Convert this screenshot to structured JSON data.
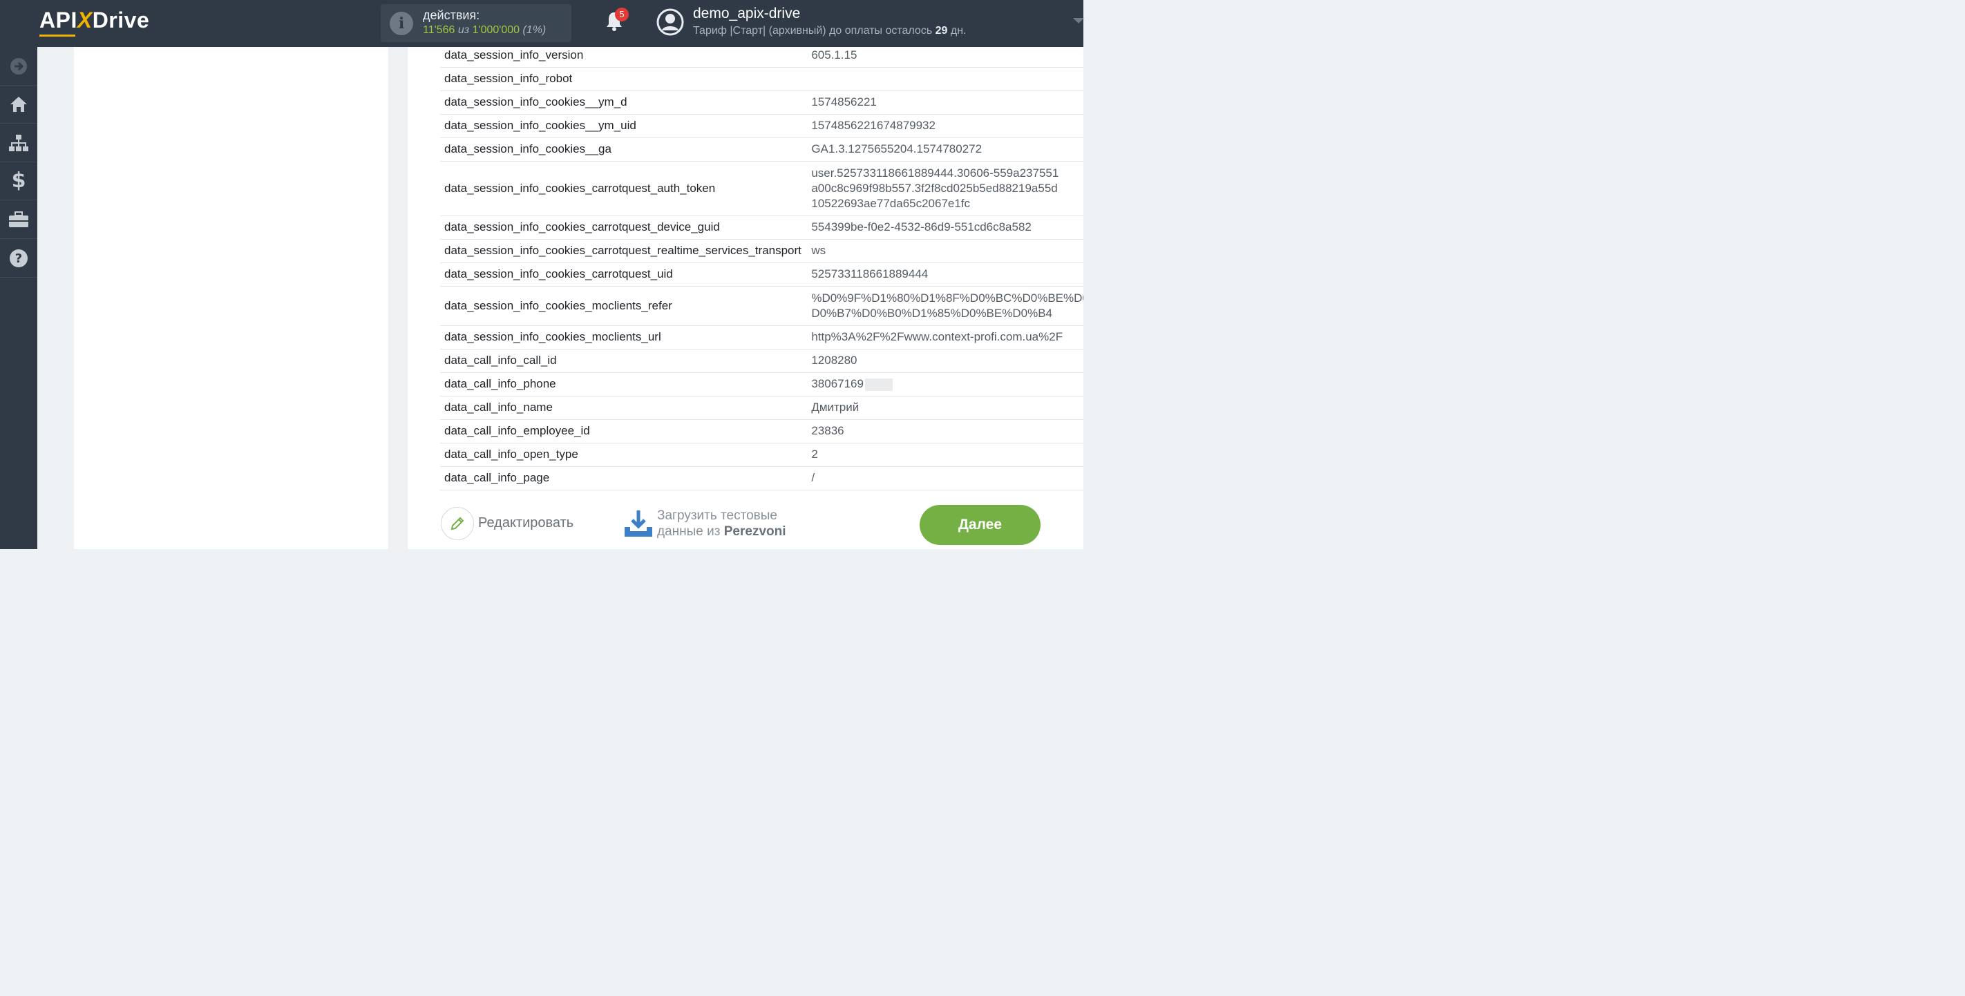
{
  "header": {
    "logo": {
      "prefix": "API",
      "x": "X",
      "suffix": "Drive"
    },
    "actions": {
      "title": "действия:",
      "used": "11'566",
      "of_word": "из",
      "total": "1'000'000",
      "percent": "(1%)"
    },
    "notifications": {
      "count": "5"
    },
    "user": {
      "name": "demo_apix-drive",
      "tariff_prefix": "Тариф |Старт| (архивный) до оплаты осталось",
      "days": "29",
      "days_suffix": "дн."
    }
  },
  "sidebar": {
    "items": [
      {
        "icon": "arrow-right-circle-icon"
      },
      {
        "icon": "home-icon"
      },
      {
        "icon": "sitemap-icon"
      },
      {
        "icon": "dollar-icon"
      },
      {
        "icon": "briefcase-icon"
      },
      {
        "icon": "question-circle-icon"
      }
    ]
  },
  "fields": [
    {
      "key": "data_session_info_version",
      "value": "605.1.15"
    },
    {
      "key": "data_session_info_robot",
      "value": ""
    },
    {
      "key": "data_session_info_cookies__ym_d",
      "value": "1574856221"
    },
    {
      "key": "data_session_info_cookies__ym_uid",
      "value": "1574856221674879932"
    },
    {
      "key": "data_session_info_cookies__ga",
      "value": "GA1.3.1275655204.1574780272"
    },
    {
      "key": "data_session_info_cookies_carrotquest_auth_token",
      "lines": [
        "user.525733118661889444.30606-559a237551",
        "a00c8c969f98b557.3f2f8cd025b5ed88219a55d",
        "10522693ae77da65c2067e1fc"
      ]
    },
    {
      "key": "data_session_info_cookies_carrotquest_device_guid",
      "value": "554399be-f0e2-4532-86d9-551cd6c8a582"
    },
    {
      "key": "data_session_info_cookies_carrotquest_realtime_services_transport",
      "value": "ws"
    },
    {
      "key": "data_session_info_cookies_carrotquest_uid",
      "value": "525733118661889444"
    },
    {
      "key": "data_session_info_cookies_moclients_refer",
      "lines": [
        "%D0%9F%D1%80%D1%8F%D0%BC%D0%BE%D0%",
        "D0%B7%D0%B0%D1%85%D0%BE%D0%B4"
      ]
    },
    {
      "key": "data_session_info_cookies_moclients_url",
      "value": "http%3A%2F%2Fwww.context-profi.com.ua%2F"
    },
    {
      "key": "data_call_info_call_id",
      "value": "1208280"
    },
    {
      "key": "data_call_info_phone",
      "value": "38067169"
    },
    {
      "key": "data_call_info_name",
      "value": "Дмитрий"
    },
    {
      "key": "data_call_info_employee_id",
      "value": "23836"
    },
    {
      "key": "data_call_info_open_type",
      "value": "2"
    },
    {
      "key": "data_call_info_page",
      "value": "/"
    }
  ],
  "footer": {
    "edit_label": "Редактировать",
    "download_line1": "Загрузить тестовые",
    "download_line2_prefix": "данные из",
    "download_service": "Perezvoni",
    "next_label": "Далее"
  },
  "colors": {
    "topbar": "#2f3a46",
    "accent_green": "#75b045",
    "counter_green": "#9dcb3f",
    "logo_yellow": "#f0b400",
    "badge_red": "#e53935"
  }
}
